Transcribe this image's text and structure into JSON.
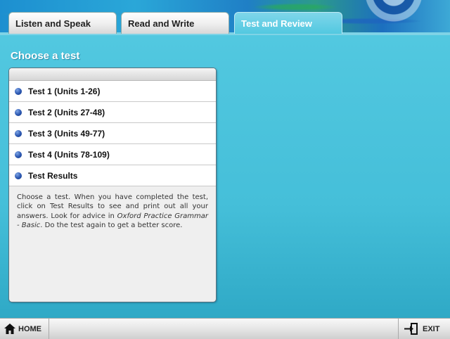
{
  "tabs": [
    {
      "label": "Listen and Speak",
      "active": false
    },
    {
      "label": "Read and Write",
      "active": false
    },
    {
      "label": "Test and Review",
      "active": true
    }
  ],
  "page_title": "Choose a test",
  "tests": [
    {
      "label": "Test 1 (Units 1-26)"
    },
    {
      "label": "Test 2 (Units 27-48)"
    },
    {
      "label": "Test 3 (Units 49-77)"
    },
    {
      "label": "Test 4 (Units 78-109)"
    },
    {
      "label": "Test Results"
    }
  ],
  "description": {
    "part1": "Choose a test. When you have completed the test, click on Test Results to see and print out all your answers. Look for advice in ",
    "book_title": "Oxford Practice Grammar - Basic",
    "part2": ". Do the test again to get a better score."
  },
  "footer": {
    "home_label": "HOME",
    "exit_label": "EXIT",
    "home_icon": "home-icon",
    "exit_icon": "exit-icon"
  },
  "colors": {
    "background": "#44c2dc",
    "bullet": "#2a56b0",
    "active_tab_text": "#ffffff"
  }
}
